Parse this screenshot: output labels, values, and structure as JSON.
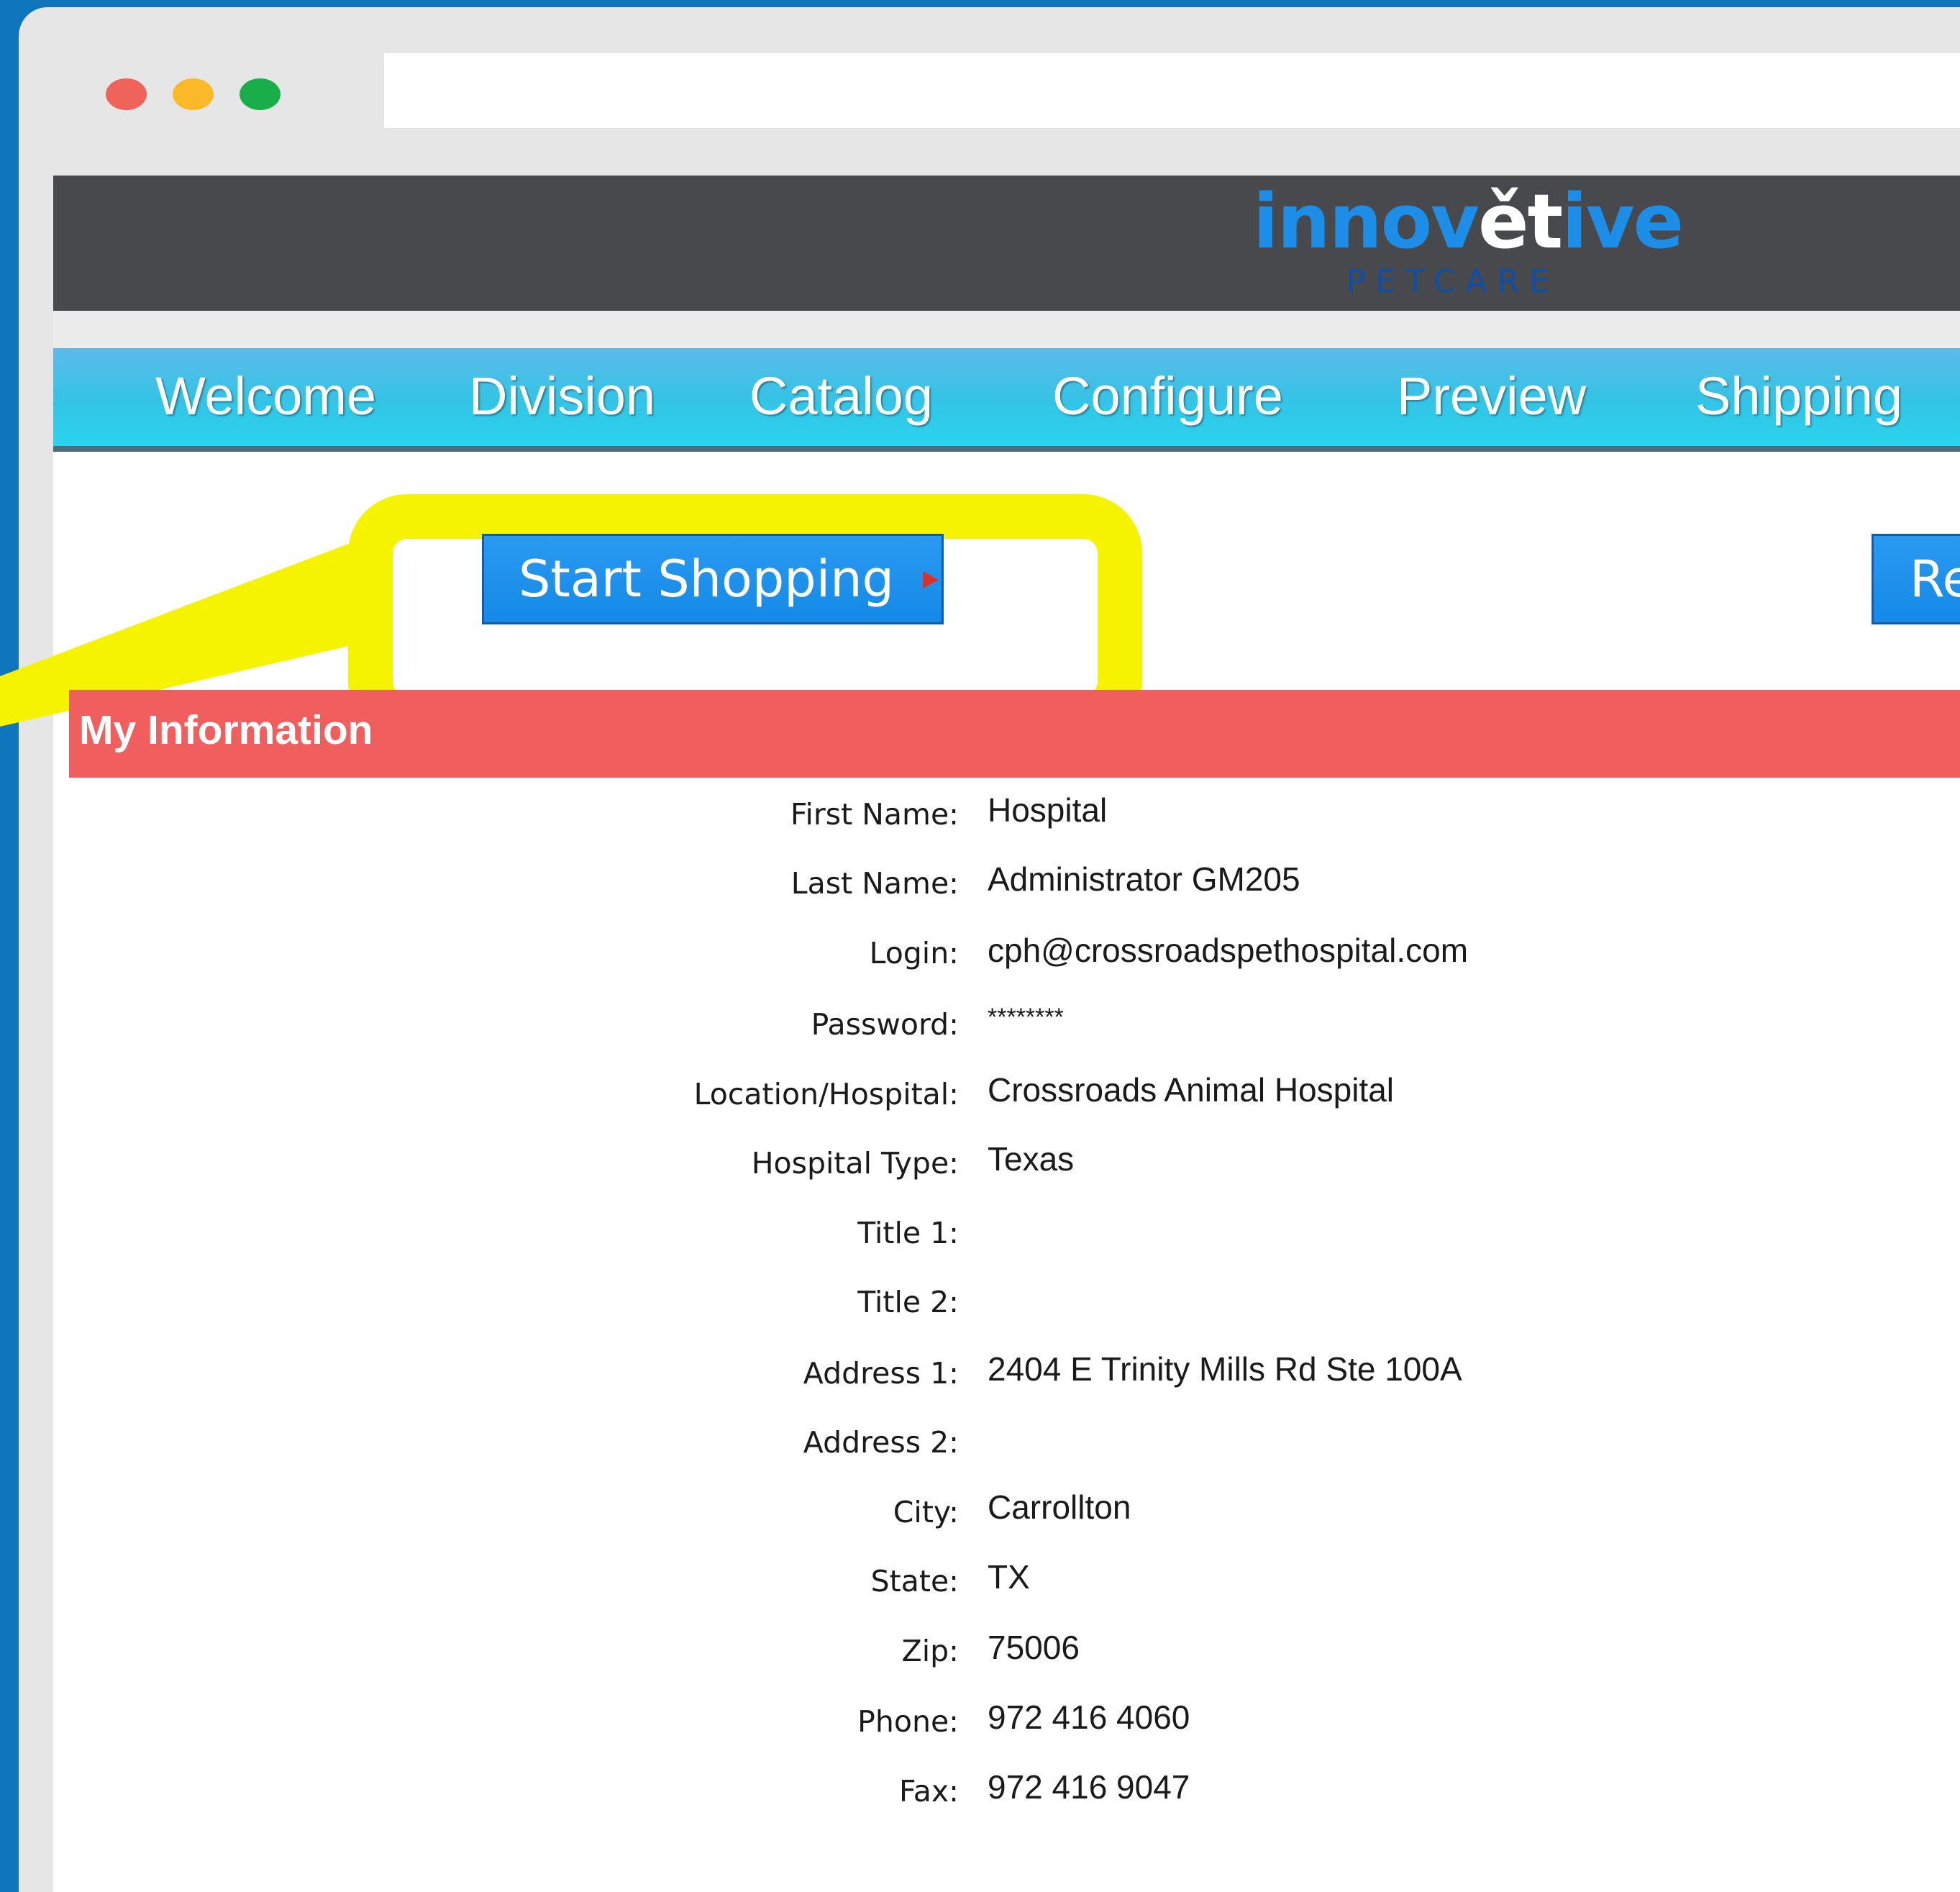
{
  "brand": {
    "logo_main_pre": "innov",
    "logo_main_accent": "ět",
    "logo_main_post": "ive",
    "logo_sub": "PETCARE"
  },
  "nav": {
    "items": [
      "Welcome",
      "Division",
      "Catalog",
      "Configure",
      "Preview",
      "Shipping"
    ]
  },
  "actions": {
    "start_shopping": "Start Shopping",
    "right_button_partial": "Re"
  },
  "section": {
    "title": "My Information"
  },
  "info": {
    "fields": [
      {
        "label": "First Name:",
        "value": "Hospital"
      },
      {
        "label": "Last Name:",
        "value": "Administrator GM205"
      },
      {
        "label": "Login:",
        "value": "cph@crossroadspethospital.com"
      },
      {
        "label": "Password:",
        "value": "********"
      },
      {
        "label": "Location/Hospital:",
        "value": "Crossroads Animal Hospital"
      },
      {
        "label": "Hospital Type:",
        "value": "Texas"
      },
      {
        "label": "Title 1:",
        "value": ""
      },
      {
        "label": "Title 2:",
        "value": ""
      },
      {
        "label": "Address 1:",
        "value": "2404 E Trinity Mills Rd Ste 100A"
      },
      {
        "label": "Address 2:",
        "value": ""
      },
      {
        "label": "City:",
        "value": "Carrollton"
      },
      {
        "label": "State:",
        "value": "TX"
      },
      {
        "label": "Zip:",
        "value": "75006"
      },
      {
        "label": "Phone:",
        "value": "972 416 4060"
      },
      {
        "label": "Fax:",
        "value": "972 416 9047"
      }
    ]
  },
  "colors": {
    "frame_background": "#0f76bd",
    "header_background": "#47494c",
    "logo_blue": "#1c8ee8",
    "nav_gradient_top": "#5cbbe8",
    "nav_gradient_bottom": "#2ad4ef",
    "button_blue": "#1489e8",
    "section_red": "#f15e5e",
    "highlight_yellow": "#f5f300"
  },
  "icons": {
    "window_controls": [
      "close-dot",
      "minimize-dot",
      "maximize-dot"
    ],
    "button_arrow": "play-triangle-icon"
  }
}
